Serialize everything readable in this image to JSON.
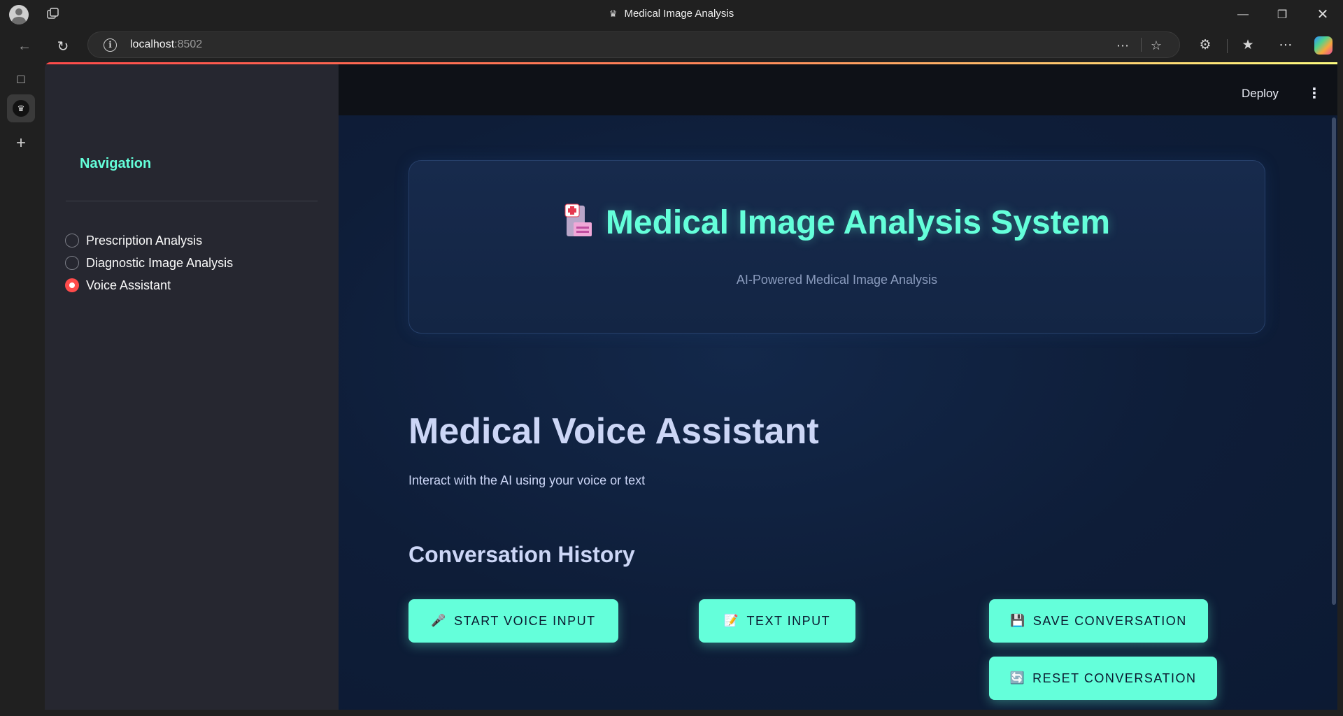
{
  "browser": {
    "tab_title": "Medical Image Analysis",
    "url_host": "localhost",
    "url_port": ":8502"
  },
  "sidebar": {
    "title": "Navigation",
    "options": [
      {
        "label": "Prescription Analysis",
        "selected": false
      },
      {
        "label": "Diagnostic Image Analysis",
        "selected": false
      },
      {
        "label": "Voice Assistant",
        "selected": true
      }
    ]
  },
  "header": {
    "deploy_label": "Deploy"
  },
  "hero": {
    "icon": "hospital-icon",
    "title": "Medical Image Analysis System",
    "subtitle": "AI-Powered Medical Image Analysis"
  },
  "main": {
    "heading": "Medical Voice Assistant",
    "description": "Interact with the AI using your voice or text",
    "subheading": "Conversation History"
  },
  "buttons": [
    {
      "icon": "🎤",
      "label": "START VOICE INPUT"
    },
    {
      "icon": "📝",
      "label": "TEXT INPUT"
    },
    {
      "icon": "💾",
      "label": "SAVE CONVERSATION"
    },
    {
      "icon": "🔄",
      "label": "RESET CONVERSATION"
    }
  ],
  "colors": {
    "accent": "#64ffda",
    "sidebar_bg": "#262730",
    "main_bg": "#0c1a33",
    "radio_selected": "#ff4b4b"
  }
}
